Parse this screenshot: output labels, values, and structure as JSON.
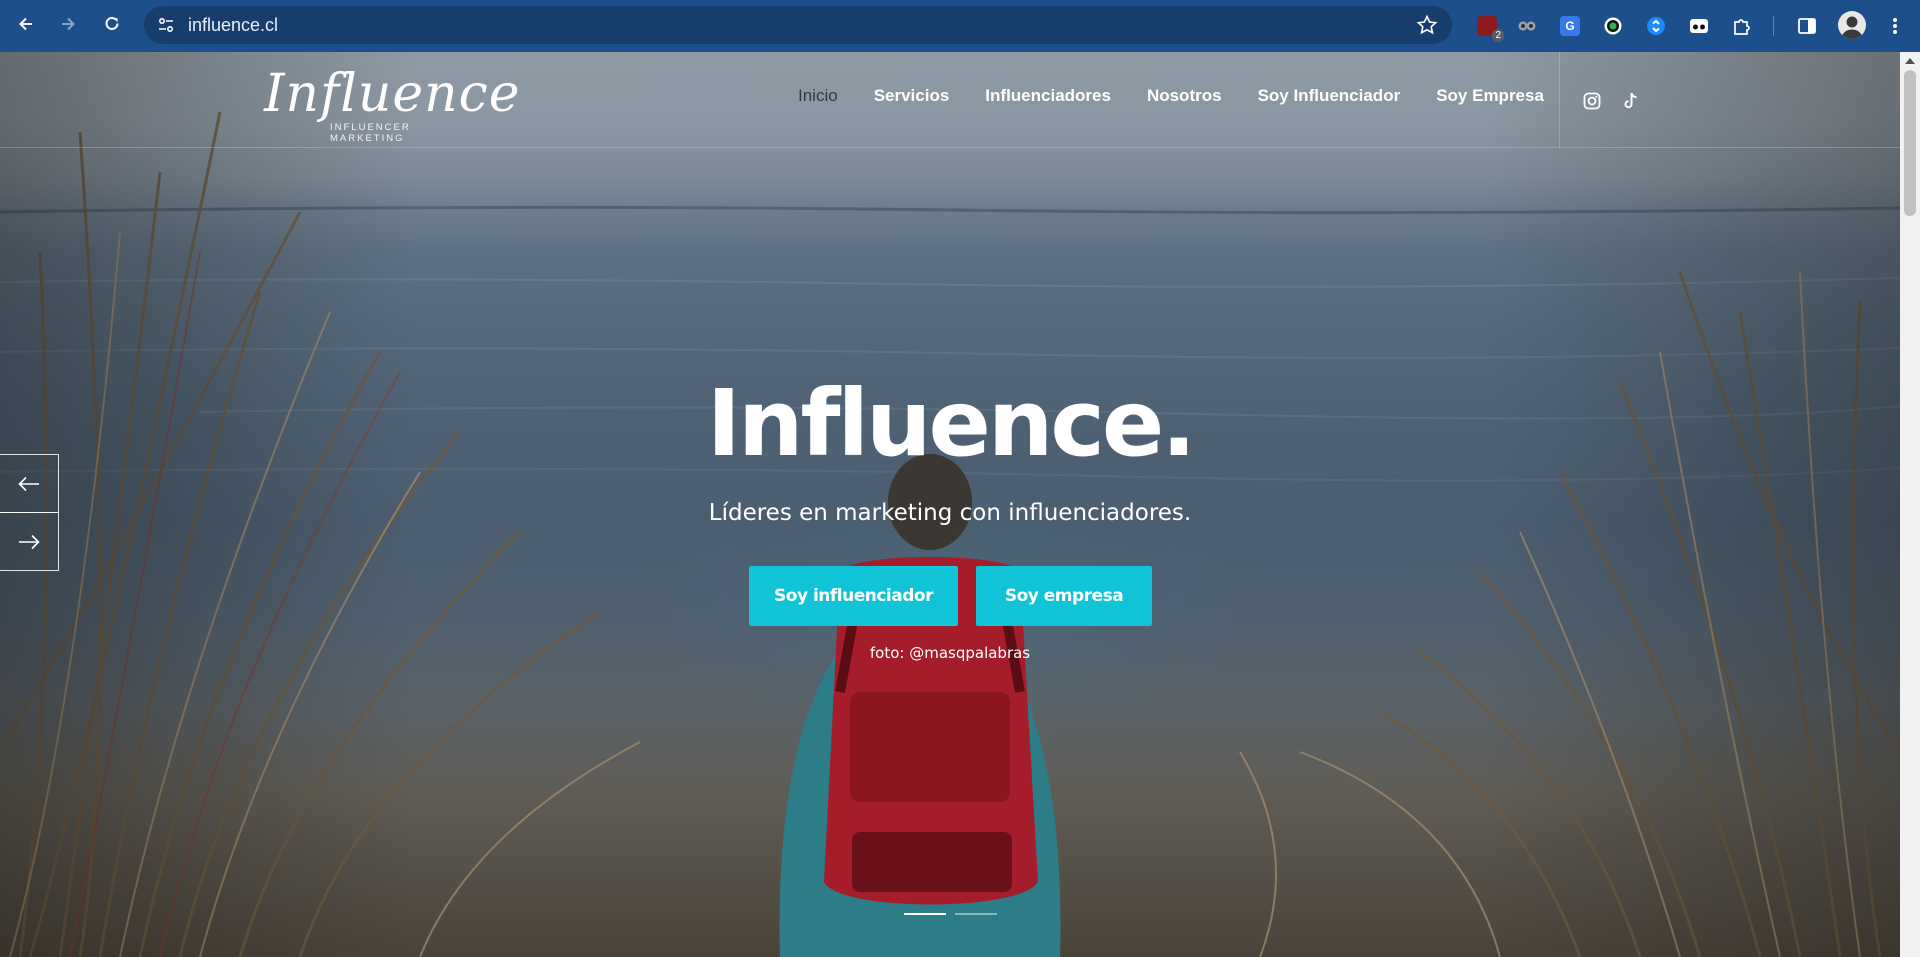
{
  "browser": {
    "url": "influence.cl",
    "extension_badge_count": "2"
  },
  "site": {
    "logo_script": "Influence",
    "logo_tagline": "INFLUENCER MARKETING",
    "nav": [
      {
        "label": "Inicio",
        "active": true
      },
      {
        "label": "Servicios",
        "active": false
      },
      {
        "label": "Influenciadores",
        "active": false
      },
      {
        "label": "Nosotros",
        "active": false
      },
      {
        "label": "Soy Influenciador",
        "active": false
      },
      {
        "label": "Soy Empresa",
        "active": false
      }
    ],
    "social_icons": [
      "instagram-icon",
      "tiktok-icon"
    ]
  },
  "hero": {
    "title": "Influence.",
    "subtitle": "Líderes en marketing con influenciadores.",
    "cta_primary": "Soy influenciador",
    "cta_secondary": "Soy empresa",
    "photo_credit": "foto: @masqpalabras",
    "slides": {
      "total": 2,
      "active": 1
    }
  },
  "colors": {
    "chrome": "#1c4f8c",
    "omnibox": "#163d6b",
    "cta": "#10c3d6"
  }
}
